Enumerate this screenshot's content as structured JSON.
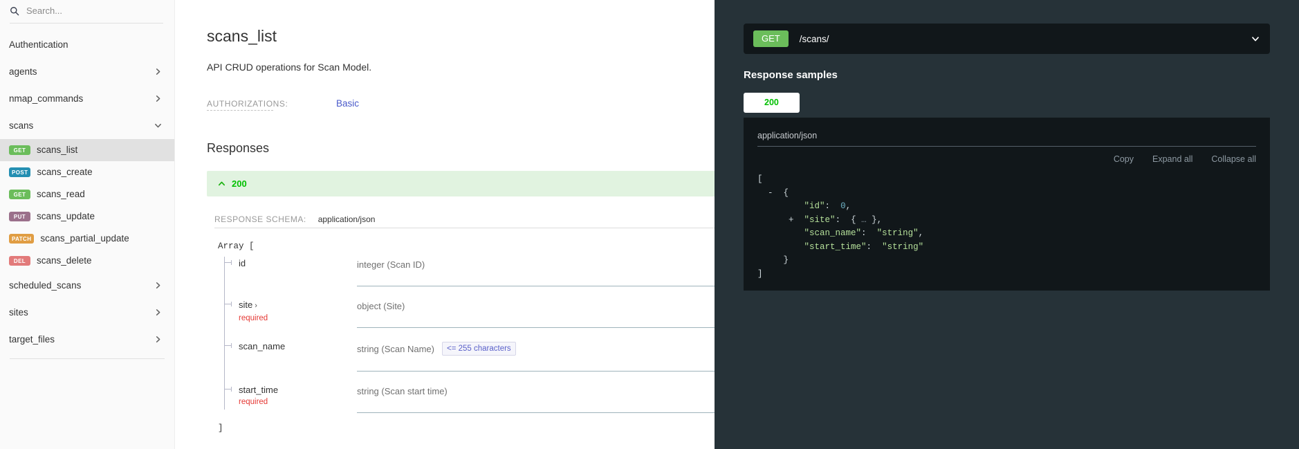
{
  "sidebar": {
    "search": {
      "placeholder": "Search...",
      "value": "",
      "icon": "search-icon"
    },
    "items": [
      {
        "label": "Authentication",
        "type": "section",
        "chevron": ""
      },
      {
        "label": "agents",
        "type": "group",
        "chevron": "chevron-right-icon"
      },
      {
        "label": "nmap_commands",
        "type": "group",
        "chevron": "chevron-right-icon"
      },
      {
        "label": "scans",
        "type": "group",
        "chevron": "chevron-down-icon"
      },
      {
        "label": "scans_list",
        "type": "operation",
        "verb": "GET",
        "verb_class": "get",
        "active": true
      },
      {
        "label": "scans_create",
        "type": "operation",
        "verb": "POST",
        "verb_class": "post",
        "active": false
      },
      {
        "label": "scans_read",
        "type": "operation",
        "verb": "GET",
        "verb_class": "get",
        "active": false
      },
      {
        "label": "scans_update",
        "type": "operation",
        "verb": "PUT",
        "verb_class": "put",
        "active": false
      },
      {
        "label": "scans_partial_update",
        "type": "operation",
        "verb": "PATCH",
        "verb_class": "patch",
        "active": false
      },
      {
        "label": "scans_delete",
        "type": "operation",
        "verb": "DEL",
        "verb_class": "del",
        "active": false
      },
      {
        "label": "scheduled_scans",
        "type": "group",
        "chevron": "chevron-right-icon"
      },
      {
        "label": "sites",
        "type": "group",
        "chevron": "chevron-right-icon"
      },
      {
        "label": "target_files",
        "type": "group",
        "chevron": "chevron-right-icon"
      }
    ]
  },
  "main": {
    "title": "scans_list",
    "description": "API CRUD operations for Scan Model.",
    "authorizations_label": "AUTHORIZATIONS:",
    "authorizations_value": "Basic",
    "responses_heading": "Responses",
    "response_code": "200",
    "schema_label": "RESPONSE SCHEMA:",
    "schema_mime": "application/json",
    "array_open": "Array [",
    "array_close": "]",
    "fields": [
      {
        "name": "id",
        "expandable": false,
        "required": false,
        "required_label": "",
        "type": "integer (Scan ID)",
        "constraint": ""
      },
      {
        "name": "site",
        "expandable": true,
        "required": true,
        "required_label": "required",
        "type": "object (Site)",
        "constraint": ""
      },
      {
        "name": "scan_name",
        "expandable": false,
        "required": false,
        "required_label": "",
        "type": "string (Scan Name)",
        "constraint": "<= 255 characters"
      },
      {
        "name": "start_time",
        "expandable": false,
        "required": true,
        "required_label": "required",
        "type": "string (Scan start time)",
        "constraint": ""
      }
    ]
  },
  "rightpanel": {
    "endpoint_verb": "GET",
    "endpoint_path": "/scans/",
    "samples_title": "Response samples",
    "tabs": [
      {
        "label": "200",
        "active": true
      }
    ],
    "mime": "application/json",
    "tools": [
      "Copy",
      "Expand all",
      "Collapse all"
    ],
    "code_lines": [
      "[",
      "  -  {",
      "         \"id\":  0,",
      "      +  \"site\":  {  …  },",
      "         \"scan_name\":  \"string\",",
      "         \"start_time\":  \"string\"",
      "     }",
      "]"
    ]
  },
  "colors": {
    "get": "#6bbd5b",
    "post": "#248fb2",
    "put": "#9b708b",
    "patch": "#e09d43",
    "del": "#e27a7a",
    "panel_bg": "#263238",
    "code_bg": "#11171a",
    "success": "#00c000",
    "success_bg": "#e1f3e0",
    "link": "#4a5aca"
  }
}
